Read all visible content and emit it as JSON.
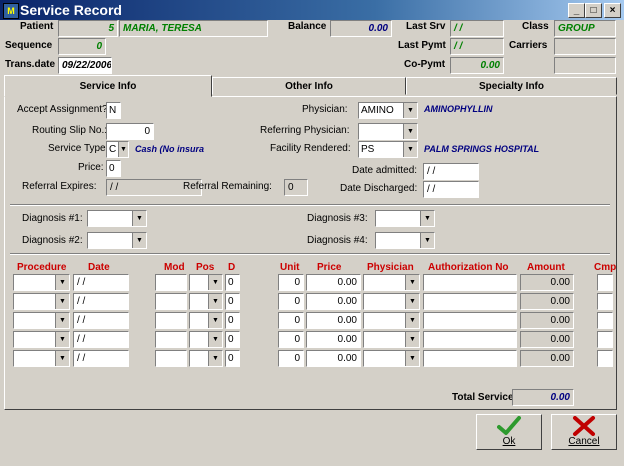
{
  "window": {
    "title": "Service Record",
    "icon_text": "M",
    "min": "_",
    "max": "□",
    "close": "×"
  },
  "header": {
    "patient_label": "Patient",
    "patient_id": "5",
    "patient_name": "MARIA, TERESA",
    "balance_label": "Balance",
    "balance_value": "0.00",
    "last_srv_label": "Last Srv",
    "last_srv_value": "/ /",
    "class_label": "Class",
    "class_value": "GROUP",
    "sequence_label": "Sequence",
    "sequence_value": "0",
    "last_pymt_label": "Last Pymt",
    "last_pymt_value": "/ /",
    "carriers_label": "Carriers",
    "trans_date_label": "Trans.date",
    "trans_date_value": "09/22/2006",
    "co_pymt_label": "Co-Pymt",
    "co_pymt_value": "0.00"
  },
  "tabs": [
    {
      "label": "Service Info"
    },
    {
      "label": "Other Info"
    },
    {
      "label": "Specialty Info"
    }
  ],
  "service_info": {
    "accept_assignment_label": "Accept Assignment?",
    "accept_assignment_value": "N",
    "routing_slip_label": "Routing Slip No.:",
    "routing_slip_value": "0",
    "service_type_label": "Service Type:",
    "service_type_value": "C",
    "service_type_desc": "Cash (No insura",
    "price_label": "Price:",
    "price_value": "0",
    "referral_expires_label": "Referral Expires:",
    "referral_expires_value": "/ /",
    "referral_remaining_label": "Referral Remaining:",
    "referral_remaining_value": "0",
    "physician_label": "Physician:",
    "physician_value": "AMINO",
    "physician_desc": "AMINOPHYLLIN",
    "referring_physician_label": "Referring Physician:",
    "facility_label": "Facility Rendered:",
    "facility_value": "PS",
    "facility_desc": "PALM SPRINGS HOSPITAL",
    "date_admitted_label": "Date admitted:",
    "date_admitted_value": "/ /",
    "date_discharged_label": "Date Discharged:",
    "date_discharged_value": "/ /"
  },
  "diagnosis": {
    "d1": "Diagnosis #1:",
    "d2": "Diagnosis #2:",
    "d3": "Diagnosis #3:",
    "d4": "Diagnosis #4:"
  },
  "grid": {
    "headers": {
      "procedure": "Procedure",
      "date": "Date",
      "mod": "Mod",
      "pos": "Pos",
      "d": "D",
      "unit": "Unit",
      "price": "Price",
      "physician": "Physician",
      "auth": "Authorization No",
      "amount": "Amount",
      "cmp": "Cmp"
    },
    "rows": [
      {
        "date": "/ /",
        "d": "0",
        "unit": "0",
        "price": "0.00",
        "amount": "0.00"
      },
      {
        "date": "/ /",
        "d": "0",
        "unit": "0",
        "price": "0.00",
        "amount": "0.00"
      },
      {
        "date": "/ /",
        "d": "0",
        "unit": "0",
        "price": "0.00",
        "amount": "0.00"
      },
      {
        "date": "/ /",
        "d": "0",
        "unit": "0",
        "price": "0.00",
        "amount": "0.00"
      },
      {
        "date": "/ /",
        "d": "0",
        "unit": "0",
        "price": "0.00",
        "amount": "0.00"
      }
    ],
    "total_service_label": "Total Service",
    "total_service_value": "0.00"
  },
  "buttons": {
    "ok": "Ok",
    "cancel": "Cancel"
  },
  "colors": {
    "title_start": "#0a246a",
    "green_text": "#008000",
    "blue_text": "#000080",
    "header_red": "#cc0000",
    "ok_check": "#2e9a2e",
    "cancel_x": "#c00000"
  },
  "icons": {
    "ok": "check-icon",
    "cancel": "x-icon"
  }
}
